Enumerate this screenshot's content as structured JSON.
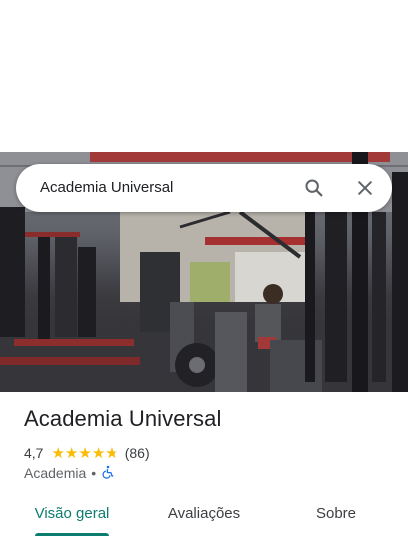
{
  "search": {
    "query": "Academia Universal",
    "search_icon": "search-icon",
    "close_icon": "close-icon"
  },
  "photo": {
    "subject": "gym-interior-photo"
  },
  "place": {
    "name": "Academia Universal",
    "rating": "4,7",
    "rating_value": 4.7,
    "reviews_count": "(86)",
    "category": "Academia",
    "separator": "•",
    "accessibility_icon": "wheelchair-icon"
  },
  "tabs": [
    {
      "label": "Visão geral",
      "active": true
    },
    {
      "label": "Avaliações",
      "active": false
    },
    {
      "label": "Sobre",
      "active": false
    }
  ],
  "colors": {
    "accent": "#0b7d70",
    "star": "#fbbc04",
    "accessibility": "#1a73e8"
  }
}
